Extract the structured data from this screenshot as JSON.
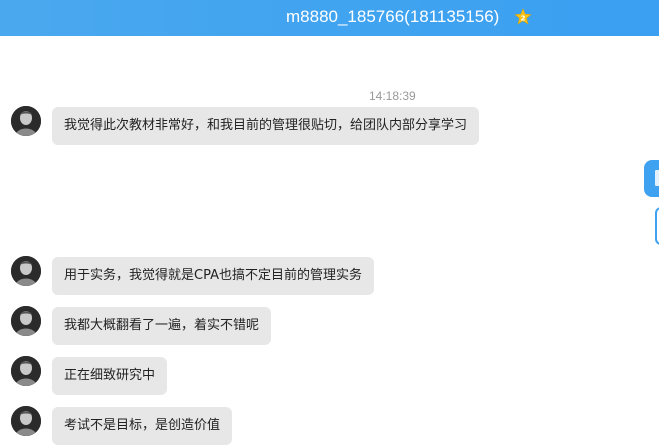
{
  "header": {
    "title": "m8880_185766(181135156)",
    "badge_icon": "star-badge-icon"
  },
  "chat": {
    "timestamp": "14:18:39",
    "messages": [
      {
        "sender": "contact",
        "avatar_icon": "contact-avatar",
        "text": "我觉得此次教材非常好，和我目前的管理很贴切，给团队内部分享学习"
      },
      {
        "sender": "contact",
        "avatar_icon": "contact-avatar",
        "text": "用于实务，我觉得就是CPA也搞不定目前的管理实务"
      },
      {
        "sender": "contact",
        "avatar_icon": "contact-avatar",
        "text": "我都大概翻看了一遍，着实不错呢"
      },
      {
        "sender": "contact",
        "avatar_icon": "contact-avatar",
        "text": "正在细致研究中"
      },
      {
        "sender": "contact",
        "avatar_icon": "contact-avatar",
        "text": "考试不是目标，是创造价值"
      }
    ]
  },
  "colors": {
    "header_bg": "#3fa3f0",
    "incoming_bubble": "#e7e7e7",
    "outgoing_bubble": "#3ea2f0",
    "timestamp_text": "#999999"
  }
}
